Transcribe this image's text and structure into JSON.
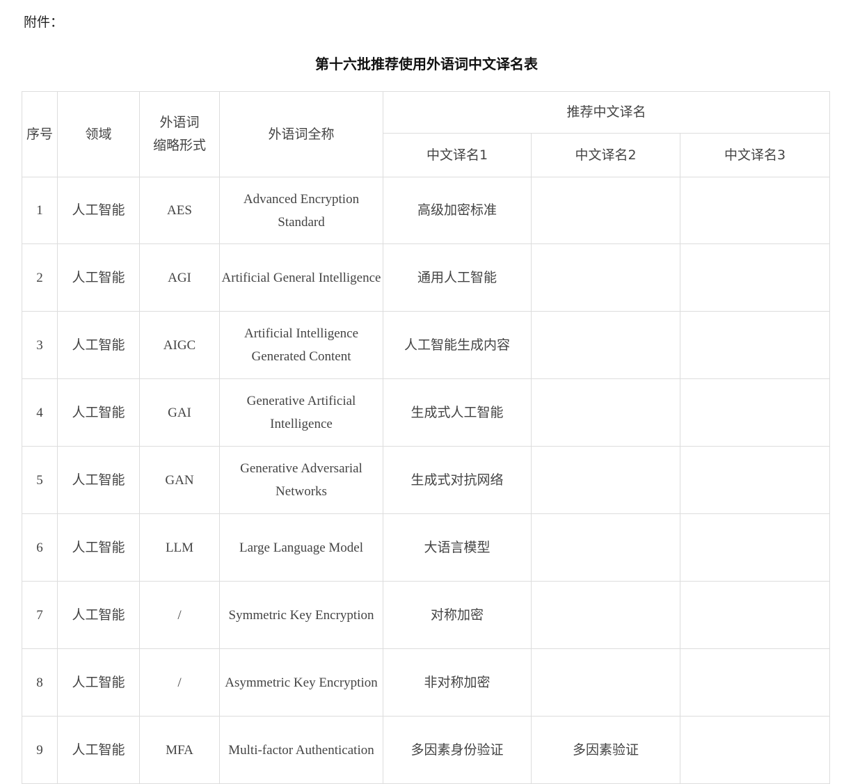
{
  "attachment_label": "附件：",
  "title": "第十六批推荐使用外语词中文译名表",
  "table": {
    "headers": {
      "index": "序号",
      "field": "领域",
      "abbr": "外语词\n缩略形式",
      "full_name": "外语词全称",
      "recommended": "推荐中文译名",
      "name1": "中文译名1",
      "name2": "中文译名2",
      "name3": "中文译名3"
    },
    "rows": [
      {
        "index": "1",
        "field": "人工智能",
        "abbr": "AES",
        "full_name": "Advanced Encryption Standard",
        "name1": "高级加密标准",
        "name2": "",
        "name3": ""
      },
      {
        "index": "2",
        "field": "人工智能",
        "abbr": "AGI",
        "full_name": "Artificial General Intelligence",
        "name1": "通用人工智能",
        "name2": "",
        "name3": ""
      },
      {
        "index": "3",
        "field": "人工智能",
        "abbr": "AIGC",
        "full_name": "Artificial Intelligence Generated Content",
        "name1": "人工智能生成内容",
        "name2": "",
        "name3": ""
      },
      {
        "index": "4",
        "field": "人工智能",
        "abbr": "GAI",
        "full_name": "Generative Artificial Intelligence",
        "name1": "生成式人工智能",
        "name2": "",
        "name3": ""
      },
      {
        "index": "5",
        "field": "人工智能",
        "abbr": "GAN",
        "full_name": "Generative Adversarial Networks",
        "name1": "生成式对抗网络",
        "name2": "",
        "name3": ""
      },
      {
        "index": "6",
        "field": "人工智能",
        "abbr": "LLM",
        "full_name": "Large Language Model",
        "name1": "大语言模型",
        "name2": "",
        "name3": ""
      },
      {
        "index": "7",
        "field": "人工智能",
        "abbr": "/",
        "full_name": "Symmetric Key Encryption",
        "name1": "对称加密",
        "name2": "",
        "name3": ""
      },
      {
        "index": "8",
        "field": "人工智能",
        "abbr": "/",
        "full_name": "Asymmetric Key Encryption",
        "name1": "非对称加密",
        "name2": "",
        "name3": ""
      },
      {
        "index": "9",
        "field": "人工智能",
        "abbr": "MFA",
        "full_name": "Multi-factor Authentication",
        "name1": "多因素身份验证",
        "name2": "多因素验证",
        "name3": ""
      }
    ]
  }
}
